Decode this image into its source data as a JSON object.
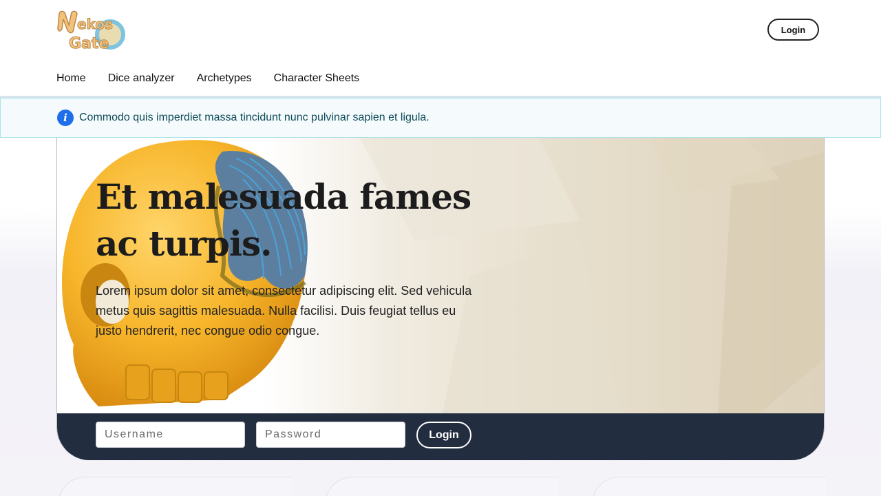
{
  "header": {
    "logo_text": "Nekos Gate",
    "login_label": "Login"
  },
  "nav": {
    "items": [
      {
        "label": "Home"
      },
      {
        "label": "Dice analyzer"
      },
      {
        "label": "Archetypes"
      },
      {
        "label": "Character Sheets"
      }
    ]
  },
  "banner": {
    "icon": "info-icon",
    "text": "Commodo quis imperdiet massa tincidunt nunc pulvinar sapien et ligula."
  },
  "hero": {
    "title": "Et malesuada fames ac turpis.",
    "body": "Lorem ipsum dolor sit amet, consectetur adipiscing elit. Sed vehicula metus quis sagittis malesuada. Nulla facilisi. Duis feugiat tellus eu justo hendrerit, nec congue odio congue.",
    "image": "golden-skull-image"
  },
  "login_form": {
    "username_placeholder": "Username",
    "password_placeholder": "Password",
    "submit_label": "Login"
  },
  "colors": {
    "banner_bg": "#f5fbfd",
    "banner_border": "#a9e2ea",
    "info_icon": "#1f6feb",
    "login_bar": "#222d3f"
  }
}
